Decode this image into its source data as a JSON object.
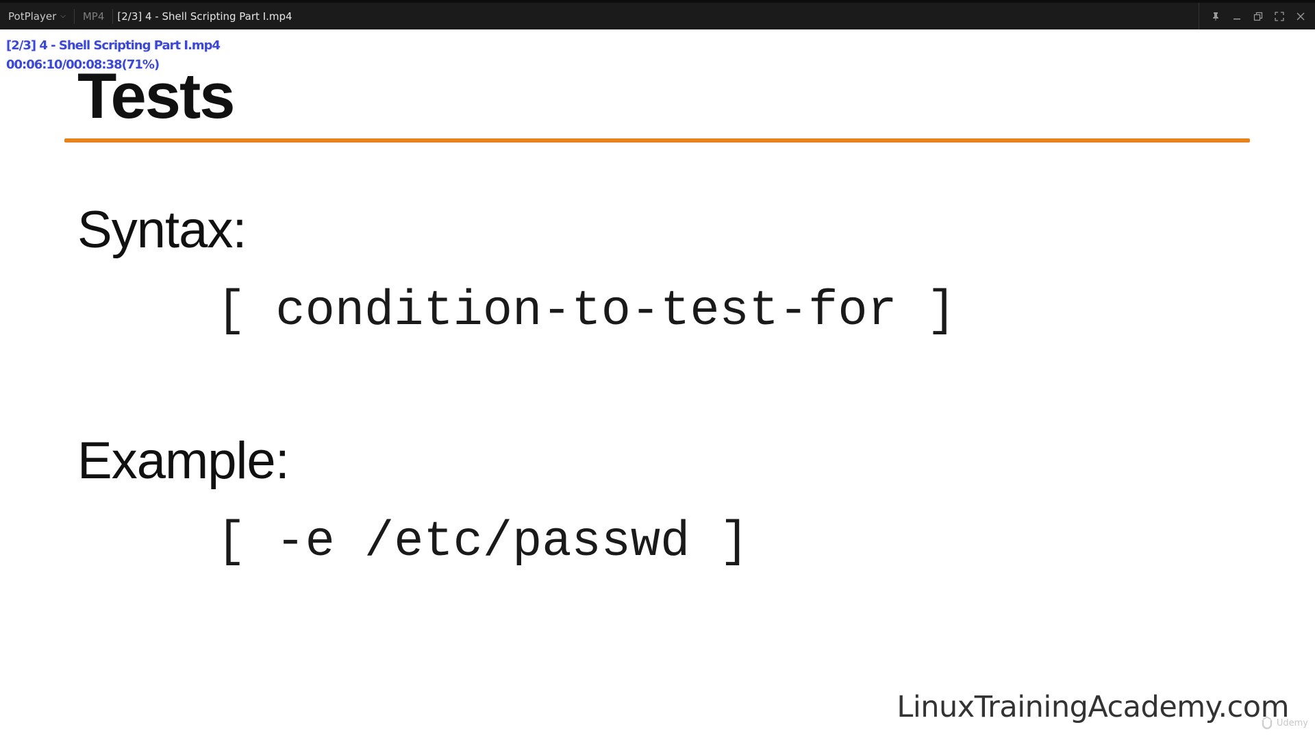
{
  "titlebar": {
    "app_name": "PotPlayer",
    "format": "MP4",
    "file_title": "[2/3] 4 - Shell Scripting Part I.mp4"
  },
  "osd": {
    "file_line": "[2/3] 4 - Shell Scripting Part I.mp4",
    "time_line": "00:06:10/00:08:38(71%)"
  },
  "slide": {
    "title": "Tests",
    "syntax_heading": "Syntax:",
    "syntax_code": "[ condition-to-test-for ]",
    "example_heading": "Example:",
    "example_code": "[ -e /etc/passwd ]",
    "brand": "LinuxTrainingAcademy.com",
    "watermark": "Udemy"
  },
  "colors": {
    "accent_rule": "#e8821d",
    "titlebar_bg": "#1b1b1b",
    "osd_text": "#3b47d6"
  },
  "icons": [
    "chevron-down-icon",
    "pin-icon",
    "minimize-icon",
    "restore-icon",
    "fullscreen-icon",
    "close-icon",
    "udemy-logo-icon"
  ]
}
